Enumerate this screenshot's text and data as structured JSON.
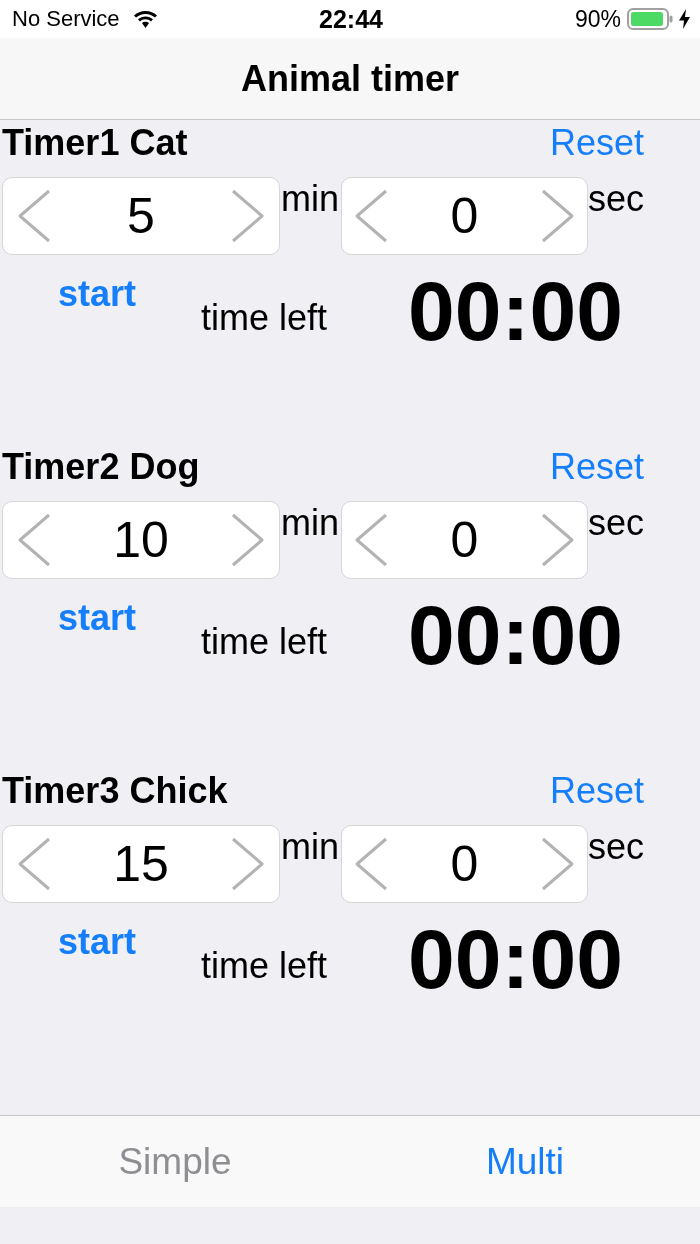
{
  "status_bar": {
    "carrier": "No Service",
    "time": "22:44",
    "battery": "90%"
  },
  "nav_bar": {
    "title": "Animal timer"
  },
  "timers": [
    {
      "title": "Timer1 Cat",
      "reset": "Reset",
      "minutes": {
        "value": "5",
        "unit": "min"
      },
      "seconds": {
        "value": "0",
        "unit": "sec"
      },
      "start": "start",
      "time_left_label": "time left",
      "time_left": "00:00"
    },
    {
      "title": "Timer2 Dog",
      "reset": "Reset",
      "minutes": {
        "value": "10",
        "unit": "min"
      },
      "seconds": {
        "value": "0",
        "unit": "sec"
      },
      "start": "start",
      "time_left_label": "time left",
      "time_left": "00:00"
    },
    {
      "title": "Timer3 Chick",
      "reset": "Reset",
      "minutes": {
        "value": "15",
        "unit": "min"
      },
      "seconds": {
        "value": "0",
        "unit": "sec"
      },
      "start": "start",
      "time_left_label": "time left",
      "time_left": "00:00"
    }
  ],
  "tab_bar": {
    "tabs": [
      {
        "label": "Simple",
        "selected": false
      },
      {
        "label": "Multi",
        "selected": true
      }
    ]
  }
}
